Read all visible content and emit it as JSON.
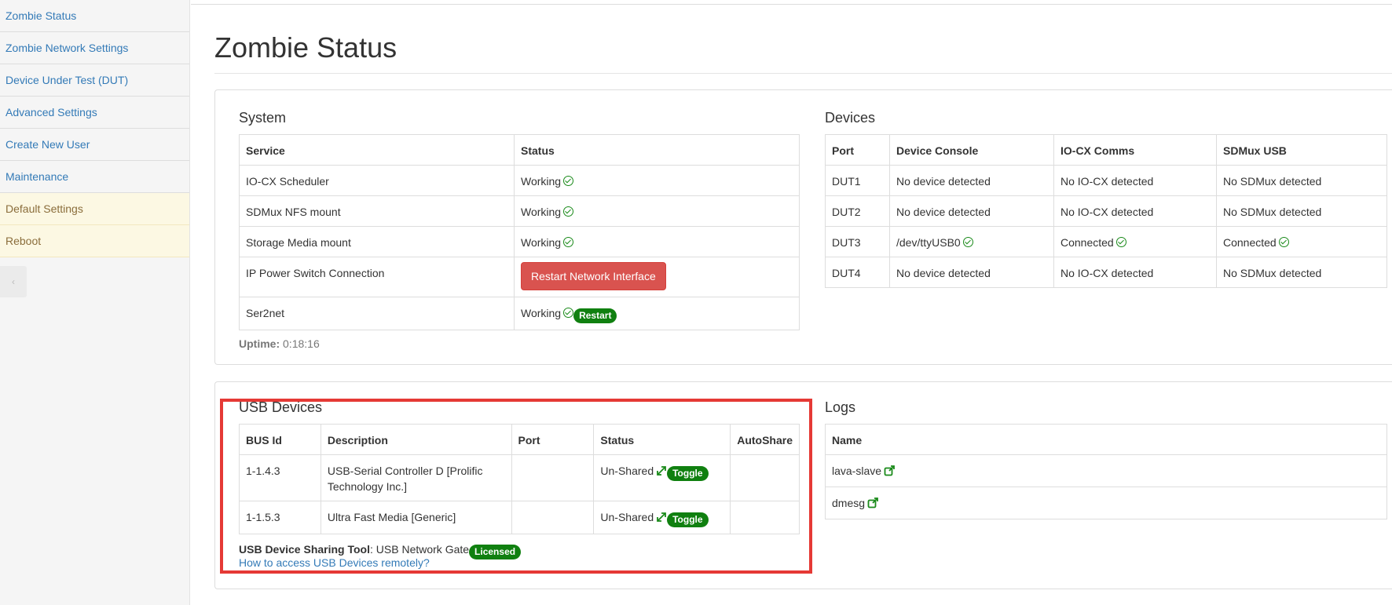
{
  "sidebar": {
    "items": [
      {
        "label": "Zombie Status"
      },
      {
        "label": "Zombie Network Settings"
      },
      {
        "label": "Device Under Test (DUT)"
      },
      {
        "label": "Advanced Settings"
      },
      {
        "label": "Create New User"
      },
      {
        "label": "Maintenance"
      },
      {
        "label": "Default Settings"
      },
      {
        "label": "Reboot"
      }
    ],
    "collapse_icon": "chevron-left-icon"
  },
  "page": {
    "title": "Zombie Status"
  },
  "system": {
    "title": "System",
    "headers": [
      "Service",
      "Status"
    ],
    "rows": [
      {
        "service": "IO-CX Scheduler",
        "status": "Working"
      },
      {
        "service": "SDMux NFS mount",
        "status": "Working"
      },
      {
        "service": "Storage Media mount",
        "status": "Working"
      },
      {
        "service": "IP Power Switch Connection",
        "button": "Restart Network Interface"
      },
      {
        "service": "Ser2net",
        "status": "Working",
        "badge": "Restart"
      }
    ],
    "uptime_label": "Uptime:",
    "uptime_value": "0:18:16"
  },
  "devices": {
    "title": "Devices",
    "headers": [
      "Port",
      "Device Console",
      "IO-CX Comms",
      "SDMux USB"
    ],
    "rows": [
      [
        "DUT1",
        "No device detected",
        "No IO-CX detected",
        "No SDMux detected"
      ],
      [
        "DUT2",
        "No device detected",
        "No IO-CX detected",
        "No SDMux detected"
      ],
      [
        "DUT3",
        "/dev/ttyUSB0",
        "Connected",
        "Connected"
      ],
      [
        "DUT4",
        "No device detected",
        "No IO-CX detected",
        "No SDMux detected"
      ]
    ]
  },
  "usb": {
    "title": "USB Devices",
    "headers": [
      "BUS Id",
      "Description",
      "Port",
      "Status",
      "AutoShare"
    ],
    "rows": [
      {
        "bus": "1-1.4.3",
        "desc": "USB-Serial Controller D [Prolific Technology Inc.]",
        "port": "",
        "status": "Un-Shared",
        "toggle": "Toggle",
        "autoshare": ""
      },
      {
        "bus": "1-1.5.3",
        "desc": "Ultra Fast Media [Generic]",
        "port": "",
        "status": "Un-Shared",
        "toggle": "Toggle",
        "autoshare": ""
      }
    ],
    "tool_label": "USB Device Sharing Tool",
    "tool_value": ": USB Network Gate",
    "tool_badge": "Licensed",
    "help_link": "How to access USB Devices remotely?"
  },
  "logs": {
    "title": "Logs",
    "headers": [
      "Name"
    ],
    "rows": [
      "lava-slave",
      "dmesg"
    ]
  },
  "colors": {
    "link": "#337ab7",
    "success": "#108010",
    "danger": "#d9534f",
    "warning_bg": "#fcf8e3",
    "highlight": "#e53935"
  }
}
